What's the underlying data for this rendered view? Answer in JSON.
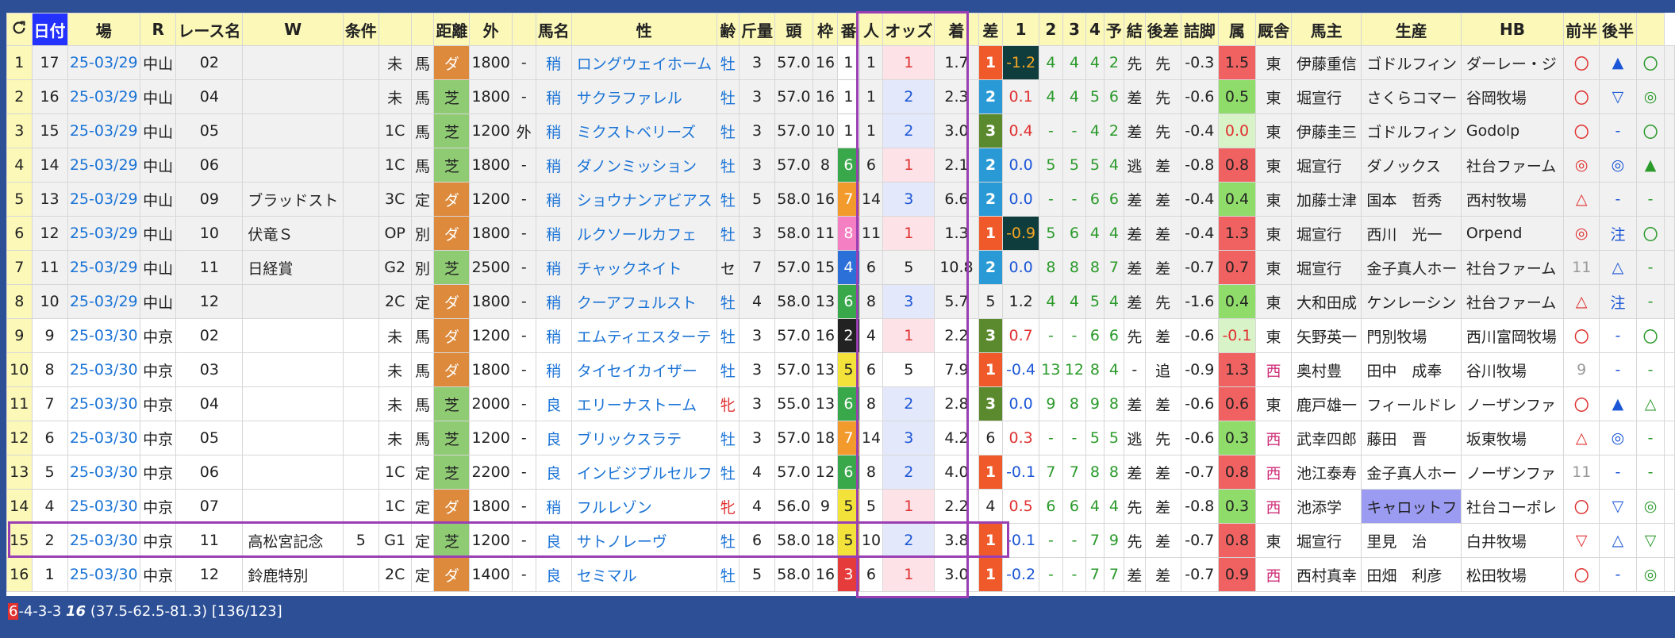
{
  "header": {
    "refresh_icon": "refresh-icon",
    "cols": [
      "",
      "日付",
      "場",
      "R",
      "レース名",
      "W",
      "条件",
      "",
      "",
      "距離",
      "外",
      "",
      "馬名",
      "性",
      "齢",
      "斤量",
      "頭",
      "枠",
      "番",
      "人",
      "オッズ",
      "着",
      "差",
      "1",
      "2",
      "3",
      "4",
      "予",
      "結",
      "後差",
      "詰脚",
      "属",
      "厩舎",
      "馬主",
      "生産",
      "HB",
      "前半",
      "後半",
      ""
    ]
  },
  "rows": [
    {
      "i": "1",
      "n": "17",
      "date": "25-03/29",
      "place": "中山",
      "r": "02",
      "race": "",
      "w": "",
      "cls": "未",
      "c2": "馬",
      "surf": "ダ",
      "dist": "1800",
      "out": "-",
      "cond": "稍",
      "horse": "ロングウェイホーム",
      "sex": "牡",
      "age": "3",
      "wt": "57.0",
      "heads": "16",
      "waku": "1",
      "ban": "1",
      "pop": "1",
      "odds": "1.7",
      "fin": "1",
      "diff": "-1.2",
      "p1": "4",
      "p2": "4",
      "p3": "4",
      "p4": "2",
      "yo": "先",
      "ke": "先",
      "ato": "-0.3",
      "tsume": "1.5",
      "zoku": "東",
      "stable": "伊藤重信",
      "owner": "ゴドルフィン",
      "breeder": "ダーレー・ジ",
      "hb": "〇",
      "zen": "▲",
      "kou": "〇"
    },
    {
      "i": "2",
      "n": "16",
      "date": "25-03/29",
      "place": "中山",
      "r": "04",
      "race": "",
      "w": "",
      "cls": "未",
      "c2": "馬",
      "surf": "芝",
      "dist": "1800",
      "out": "-",
      "cond": "稍",
      "horse": "サクラファレル",
      "sex": "牡",
      "age": "3",
      "wt": "57.0",
      "heads": "16",
      "waku": "1",
      "ban": "1",
      "pop": "2",
      "odds": "2.3",
      "fin": "2",
      "diff": "0.1",
      "p1": "4",
      "p2": "4",
      "p3": "5",
      "p4": "6",
      "yo": "差",
      "ke": "先",
      "ato": "-0.6",
      "tsume": "0.5",
      "zoku": "東",
      "stable": "堀宣行",
      "owner": "さくらコマー",
      "breeder": "谷岡牧場",
      "hb": "〇",
      "zen": "▽",
      "kou": "◎"
    },
    {
      "i": "3",
      "n": "15",
      "date": "25-03/29",
      "place": "中山",
      "r": "05",
      "race": "",
      "w": "",
      "cls": "1C",
      "c2": "馬",
      "surf": "芝",
      "dist": "1200",
      "out": "外",
      "cond": "稍",
      "horse": "ミクストベリーズ",
      "sex": "牡",
      "age": "3",
      "wt": "57.0",
      "heads": "10",
      "waku": "1",
      "ban": "1",
      "pop": "2",
      "odds": "3.0",
      "fin": "3",
      "diff": "0.4",
      "p1": "-",
      "p2": "-",
      "p3": "4",
      "p4": "2",
      "yo": "差",
      "ke": "先",
      "ato": "-0.4",
      "tsume": "0.0",
      "zoku": "東",
      "stable": "伊藤圭三",
      "owner": "ゴドルフィン",
      "breeder": "Godolp",
      "hb": "〇",
      "zen": "-",
      "kou": "〇"
    },
    {
      "i": "4",
      "n": "14",
      "date": "25-03/29",
      "place": "中山",
      "r": "06",
      "race": "",
      "w": "",
      "cls": "1C",
      "c2": "馬",
      "surf": "芝",
      "dist": "1800",
      "out": "-",
      "cond": "稍",
      "horse": "ダノンミッション",
      "sex": "牡",
      "age": "3",
      "wt": "57.0",
      "heads": "8",
      "waku": "6",
      "ban": "6",
      "pop": "1",
      "odds": "2.1",
      "fin": "2",
      "diff": "0.0",
      "p1": "5",
      "p2": "5",
      "p3": "5",
      "p4": "4",
      "yo": "逃",
      "ke": "差",
      "ato": "-0.8",
      "tsume": "0.8",
      "zoku": "東",
      "stable": "堀宣行",
      "owner": "ダノックス",
      "breeder": "社台ファーム",
      "hb": "◎",
      "zen": "◎",
      "kou": "▲"
    },
    {
      "i": "5",
      "n": "13",
      "date": "25-03/29",
      "place": "中山",
      "r": "09",
      "race": "ブラッドスト",
      "w": "",
      "cls": "3C",
      "c2": "定",
      "surf": "ダ",
      "dist": "1200",
      "out": "-",
      "cond": "稍",
      "horse": "ショウナンアビアス",
      "sex": "牡",
      "age": "5",
      "wt": "58.0",
      "heads": "16",
      "waku": "7",
      "ban": "14",
      "pop": "3",
      "odds": "6.6",
      "fin": "2",
      "diff": "0.0",
      "p1": "-",
      "p2": "-",
      "p3": "6",
      "p4": "6",
      "yo": "差",
      "ke": "差",
      "ato": "-0.4",
      "tsume": "0.4",
      "zoku": "東",
      "stable": "加藤士津",
      "owner": "国本　哲秀",
      "breeder": "西村牧場",
      "hb": "△",
      "zen": "-",
      "kou": "-"
    },
    {
      "i": "6",
      "n": "12",
      "date": "25-03/29",
      "place": "中山",
      "r": "10",
      "race": "伏竜Ｓ",
      "w": "",
      "cls": "OP",
      "c2": "別",
      "surf": "ダ",
      "dist": "1800",
      "out": "-",
      "cond": "稍",
      "horse": "ルクソールカフェ",
      "sex": "牡",
      "age": "3",
      "wt": "58.0",
      "heads": "11",
      "waku": "8",
      "ban": "11",
      "pop": "1",
      "odds": "1.3",
      "fin": "1",
      "diff": "-0.9",
      "p1": "5",
      "p2": "6",
      "p3": "4",
      "p4": "4",
      "yo": "差",
      "ke": "差",
      "ato": "-0.4",
      "tsume": "1.3",
      "zoku": "東",
      "stable": "堀宣行",
      "owner": "西川　光一",
      "breeder": "Orpend",
      "hb": "◎",
      "zen": "注",
      "kou": "〇"
    },
    {
      "i": "7",
      "n": "11",
      "date": "25-03/29",
      "place": "中山",
      "r": "11",
      "race": "日経賞",
      "w": "",
      "cls": "G2",
      "c2": "別",
      "surf": "芝",
      "dist": "2500",
      "out": "-",
      "cond": "稍",
      "horse": "チャックネイト",
      "sex": "セ",
      "age": "7",
      "wt": "57.0",
      "heads": "15",
      "waku": "4",
      "ban": "6",
      "pop": "5",
      "odds": "10.8",
      "fin": "2",
      "diff": "0.0",
      "p1": "8",
      "p2": "8",
      "p3": "8",
      "p4": "7",
      "yo": "差",
      "ke": "差",
      "ato": "-0.7",
      "tsume": "0.7",
      "zoku": "東",
      "stable": "堀宣行",
      "owner": "金子真人ホー",
      "breeder": "社台ファーム",
      "hb": "11",
      "zen": "△",
      "kou": "-"
    },
    {
      "i": "8",
      "n": "10",
      "date": "25-03/29",
      "place": "中山",
      "r": "12",
      "race": "",
      "w": "",
      "cls": "2C",
      "c2": "定",
      "surf": "ダ",
      "dist": "1800",
      "out": "-",
      "cond": "稍",
      "horse": "クーアフュルスト",
      "sex": "牡",
      "age": "4",
      "wt": "58.0",
      "heads": "13",
      "waku": "6",
      "ban": "8",
      "pop": "3",
      "odds": "5.7",
      "fin": "5",
      "diff": "1.2",
      "p1": "4",
      "p2": "4",
      "p3": "5",
      "p4": "4",
      "yo": "差",
      "ke": "先",
      "ato": "-1.6",
      "tsume": "0.4",
      "zoku": "東",
      "stable": "大和田成",
      "owner": "ケンレーシン",
      "breeder": "社台ファーム",
      "hb": "△",
      "zen": "注",
      "kou": "-"
    },
    {
      "i": "9",
      "n": "9",
      "date": "25-03/30",
      "place": "中京",
      "r": "02",
      "race": "",
      "w": "",
      "cls": "未",
      "c2": "馬",
      "surf": "ダ",
      "dist": "1200",
      "out": "-",
      "cond": "稍",
      "horse": "エムティエスターテ",
      "sex": "牡",
      "age": "3",
      "wt": "57.0",
      "heads": "16",
      "waku": "2",
      "ban": "4",
      "pop": "1",
      "odds": "2.2",
      "fin": "3",
      "diff": "0.7",
      "p1": "-",
      "p2": "-",
      "p3": "6",
      "p4": "6",
      "yo": "先",
      "ke": "差",
      "ato": "-0.6",
      "tsume": "-0.1",
      "zoku": "東",
      "stable": "矢野英一",
      "owner": "門別牧場",
      "breeder": "西川富岡牧場",
      "hb": "〇",
      "zen": "-",
      "kou": "〇"
    },
    {
      "i": "10",
      "n": "8",
      "date": "25-03/30",
      "place": "中京",
      "r": "03",
      "race": "",
      "w": "",
      "cls": "未",
      "c2": "馬",
      "surf": "ダ",
      "dist": "1800",
      "out": "-",
      "cond": "稍",
      "horse": "タイセイカイザー",
      "sex": "牡",
      "age": "3",
      "wt": "57.0",
      "heads": "13",
      "waku": "5",
      "ban": "6",
      "pop": "5",
      "odds": "7.9",
      "fin": "1",
      "diff": "-0.4",
      "p1": "13",
      "p2": "12",
      "p3": "8",
      "p4": "4",
      "yo": "-",
      "ke": "追",
      "ato": "-0.9",
      "tsume": "1.3",
      "zoku": "西",
      "stable": "奥村豊",
      "owner": "田中　成奉",
      "breeder": "谷川牧場",
      "hb": "9",
      "zen": "-",
      "kou": "-"
    },
    {
      "i": "11",
      "n": "7",
      "date": "25-03/30",
      "place": "中京",
      "r": "04",
      "race": "",
      "w": "",
      "cls": "未",
      "c2": "馬",
      "surf": "芝",
      "dist": "2000",
      "out": "-",
      "cond": "良",
      "horse": "エリーナストーム",
      "sex": "牝",
      "age": "3",
      "wt": "55.0",
      "heads": "13",
      "waku": "6",
      "ban": "8",
      "pop": "2",
      "odds": "2.8",
      "fin": "3",
      "diff": "0.0",
      "p1": "9",
      "p2": "8",
      "p3": "9",
      "p4": "8",
      "yo": "差",
      "ke": "差",
      "ato": "-0.6",
      "tsume": "0.6",
      "zoku": "東",
      "stable": "鹿戸雄一",
      "owner": "フィールドレ",
      "breeder": "ノーザンファ",
      "hb": "〇",
      "zen": "▲",
      "kou": "△"
    },
    {
      "i": "12",
      "n": "6",
      "date": "25-03/30",
      "place": "中京",
      "r": "05",
      "race": "",
      "w": "",
      "cls": "未",
      "c2": "馬",
      "surf": "芝",
      "dist": "1200",
      "out": "-",
      "cond": "良",
      "horse": "ブリックスラテ",
      "sex": "牡",
      "age": "3",
      "wt": "57.0",
      "heads": "18",
      "waku": "7",
      "ban": "14",
      "pop": "3",
      "odds": "4.2",
      "fin": "6",
      "diff": "0.3",
      "p1": "-",
      "p2": "-",
      "p3": "5",
      "p4": "5",
      "yo": "逃",
      "ke": "先",
      "ato": "-0.6",
      "tsume": "0.3",
      "zoku": "西",
      "stable": "武幸四郎",
      "owner": "藤田　晋",
      "breeder": "坂東牧場",
      "hb": "△",
      "zen": "◎",
      "kou": "-"
    },
    {
      "i": "13",
      "n": "5",
      "date": "25-03/30",
      "place": "中京",
      "r": "06",
      "race": "",
      "w": "",
      "cls": "1C",
      "c2": "定",
      "surf": "芝",
      "dist": "2200",
      "out": "-",
      "cond": "良",
      "horse": "インビジブルセルフ",
      "sex": "牡",
      "age": "4",
      "wt": "57.0",
      "heads": "12",
      "waku": "6",
      "ban": "8",
      "pop": "2",
      "odds": "4.0",
      "fin": "1",
      "diff": "-0.1",
      "p1": "7",
      "p2": "7",
      "p3": "8",
      "p4": "8",
      "yo": "差",
      "ke": "差",
      "ato": "-0.7",
      "tsume": "0.8",
      "zoku": "西",
      "stable": "池江泰寿",
      "owner": "金子真人ホー",
      "breeder": "ノーザンファ",
      "hb": "11",
      "zen": "-",
      "kou": "-"
    },
    {
      "i": "14",
      "n": "4",
      "date": "25-03/30",
      "place": "中京",
      "r": "07",
      "race": "",
      "w": "",
      "cls": "1C",
      "c2": "定",
      "surf": "ダ",
      "dist": "1800",
      "out": "-",
      "cond": "稍",
      "horse": "フルレゾン",
      "sex": "牝",
      "age": "4",
      "wt": "56.0",
      "heads": "9",
      "waku": "5",
      "ban": "5",
      "pop": "1",
      "odds": "2.2",
      "fin": "4",
      "diff": "0.5",
      "p1": "6",
      "p2": "6",
      "p3": "4",
      "p4": "4",
      "yo": "先",
      "ke": "差",
      "ato": "-0.8",
      "tsume": "0.3",
      "zoku": "西",
      "stable": "池添学",
      "owner": "キャロットフ",
      "breeder": "社台コーポレ",
      "hb": "〇",
      "zen": "▽",
      "kou": "◎"
    },
    {
      "i": "15",
      "n": "2",
      "date": "25-03/30",
      "place": "中京",
      "r": "11",
      "race": "高松宮記念",
      "w": "5",
      "cls": "G1",
      "c2": "定",
      "surf": "芝",
      "dist": "1200",
      "out": "-",
      "cond": "良",
      "horse": "サトノレーヴ",
      "sex": "牡",
      "age": "6",
      "wt": "58.0",
      "heads": "18",
      "waku": "5",
      "ban": "10",
      "pop": "2",
      "odds": "3.8",
      "fin": "1",
      "diff": "-0.1",
      "p1": "-",
      "p2": "-",
      "p3": "7",
      "p4": "9",
      "yo": "先",
      "ke": "差",
      "ato": "-0.7",
      "tsume": "0.8",
      "zoku": "東",
      "stable": "堀宣行",
      "owner": "里見　治",
      "breeder": "白井牧場",
      "hb": "▽",
      "zen": "△",
      "kou": "▽"
    },
    {
      "i": "16",
      "n": "1",
      "date": "25-03/30",
      "place": "中京",
      "r": "12",
      "race": "鈴鹿特別",
      "w": "",
      "cls": "2C",
      "c2": "定",
      "surf": "ダ",
      "dist": "1400",
      "out": "-",
      "cond": "良",
      "horse": "セミマル",
      "sex": "牡",
      "age": "5",
      "wt": "58.0",
      "heads": "16",
      "waku": "3",
      "ban": "6",
      "pop": "1",
      "odds": "3.0",
      "fin": "1",
      "diff": "-0.2",
      "p1": "-",
      "p2": "-",
      "p3": "7",
      "p4": "7",
      "yo": "差",
      "ke": "差",
      "ato": "-0.7",
      "tsume": "0.9",
      "zoku": "西",
      "stable": "西村真幸",
      "owner": "田畑　利彦",
      "breeder": "松田牧場",
      "hb": "〇",
      "zen": "-",
      "kou": "◎"
    }
  ],
  "summary": {
    "first": "6",
    "rest": "-4-3-3",
    "count": "16",
    "rates": "(37.5-62.5-81.3) [136/123]"
  }
}
